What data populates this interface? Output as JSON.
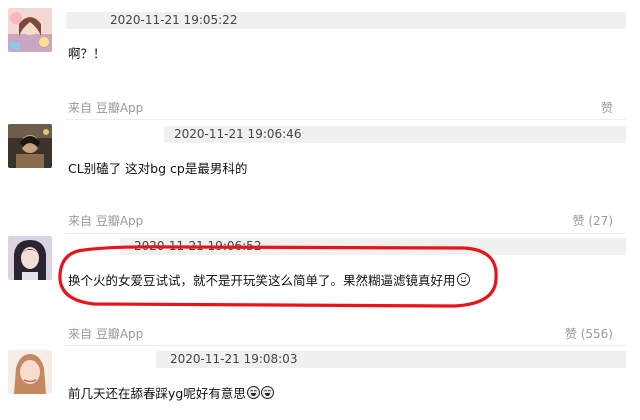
{
  "comments": [
    {
      "timestamp": "2020-11-21 19:05:22",
      "text": "啊？！",
      "from": "来自 豆瓣App",
      "like": "赞",
      "avatar": "avatar-girl-pink"
    },
    {
      "timestamp": "2020-11-21 19:06:46",
      "text": "CL别磕了 这对bg cp是最男科的",
      "from": "来自 豆瓣App",
      "like": "赞 (27)",
      "avatar": "avatar-dark-photo"
    },
    {
      "timestamp": "2020-11-21 19:06:52",
      "text": "换个火的女爱豆试试，就不是开玩笑这么简单了。果然糊逼滤镜真好用",
      "from": "来自 豆瓣App",
      "like": "赞 (556)",
      "avatar": "avatar-girl-dark-hair",
      "emoji": [
        "smile-emoji"
      ]
    },
    {
      "timestamp": "2020-11-21 19:08:03",
      "text": "前几天还在舔春踩yg呢好有意思",
      "from": "",
      "like": "",
      "avatar": "avatar-woman-portrait",
      "emoji": [
        "grin-emoji",
        "grin-emoji"
      ]
    }
  ],
  "colors": {
    "meta_bar": "#f0f0f0",
    "secondary_text": "#999999",
    "highlight_ring": "#e8141b"
  },
  "icons": {
    "more": "more-dots-icon"
  }
}
